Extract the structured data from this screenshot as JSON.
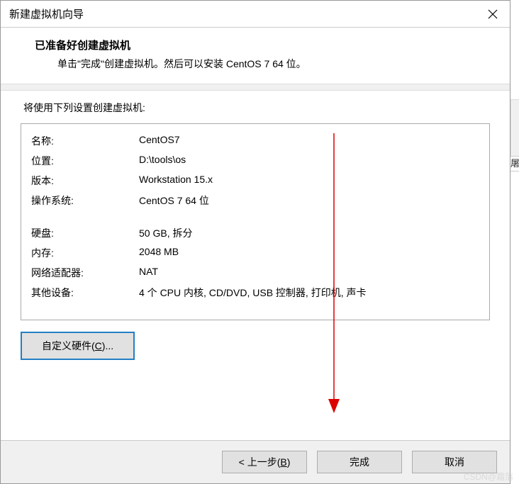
{
  "titlebar": {
    "title": "新建虚拟机向导"
  },
  "header": {
    "title": "已准备好创建虚拟机",
    "subtitle": "单击\"完成\"创建虚拟机。然后可以安装 CentOS 7 64 位。"
  },
  "settings_label": "将使用下列设置创建虚拟机:",
  "settings": {
    "name_key": "名称:",
    "name_val": "CentOS7",
    "location_key": "位置:",
    "location_val": "D:\\tools\\os",
    "version_key": "版本:",
    "version_val": "Workstation 15.x",
    "os_key": "操作系统:",
    "os_val": "CentOS 7 64 位",
    "disk_key": "硬盘:",
    "disk_val": "50 GB, 拆分",
    "memory_key": "内存:",
    "memory_val": "2048 MB",
    "network_key": "网络适配器:",
    "network_val": "NAT",
    "other_key": "其他设备:",
    "other_val": "4 个 CPU 内核, CD/DVD, USB 控制器, 打印机, 声卡"
  },
  "buttons": {
    "custom_hw_prefix": "自定义硬件(",
    "custom_hw_key": "C",
    "custom_hw_suffix": ")...",
    "back_prefix": "< 上一步(",
    "back_key": "B",
    "back_suffix": ")",
    "finish": "完成",
    "cancel": "取消"
  },
  "watermark": "CSDN@霜落",
  "decor": "屠"
}
